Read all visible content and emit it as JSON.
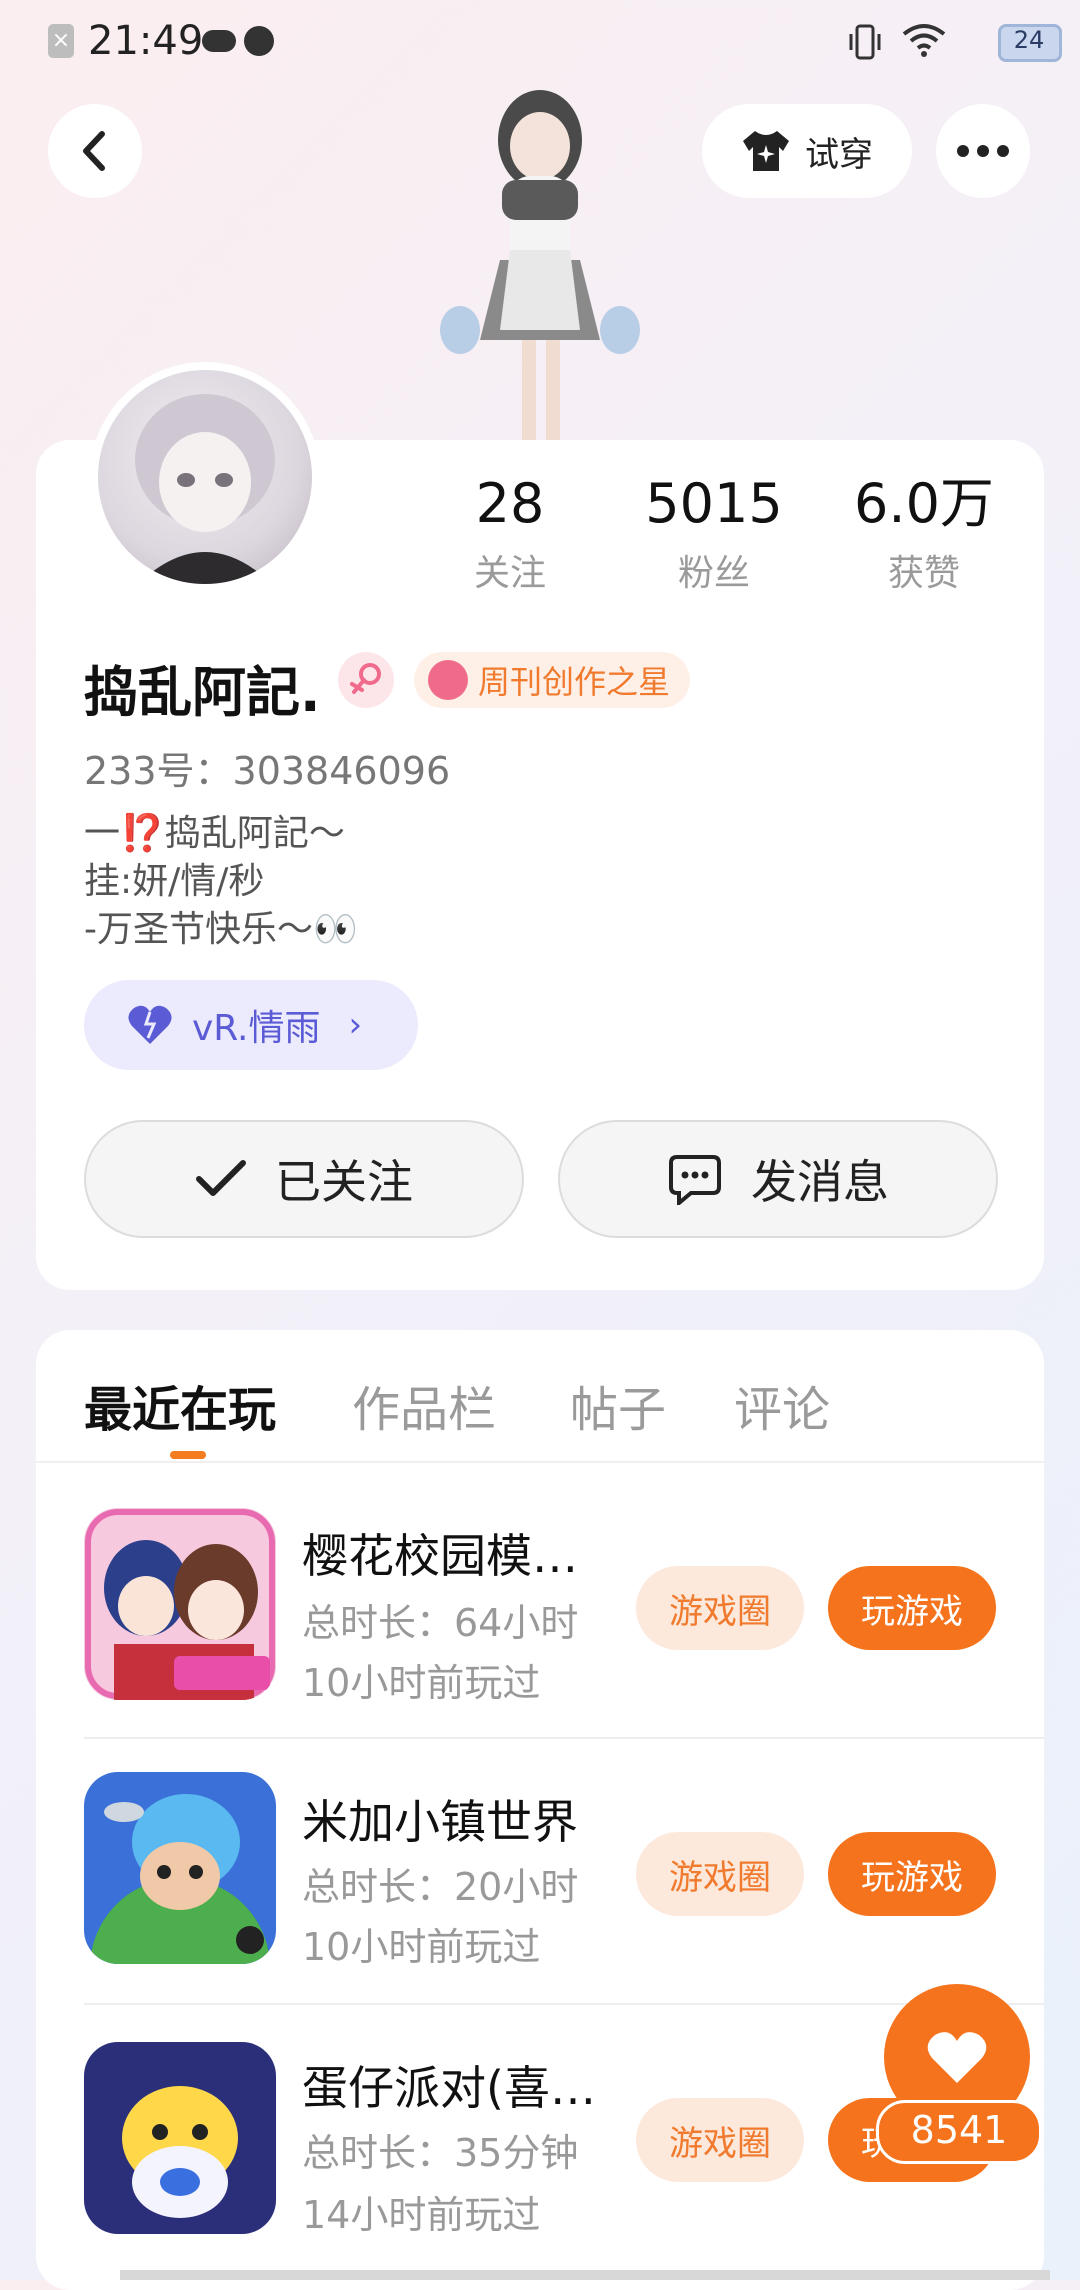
{
  "status_bar": {
    "time": "21:49",
    "battery": "24"
  },
  "header": {
    "try_on_label": "试穿",
    "back_icon": "chevron-left-icon",
    "more_icon": "more-dots-icon",
    "tryon_icon": "shirt-sparkle-icon"
  },
  "profile": {
    "stats": [
      {
        "value": "28",
        "label": "关注"
      },
      {
        "value": "5015",
        "label": "粉丝"
      },
      {
        "value": "6.0万",
        "label": "获赞"
      }
    ],
    "username": "捣乱阿記.",
    "creator_badge": "周刊创作之星",
    "user_id": "233号：303846096",
    "bio": "一⁉️捣乱阿記～\n挂:妍/情/秒\n-万圣节快乐～👀",
    "cp_name": "vR.情雨",
    "follow_label": "已关注",
    "message_label": "发消息",
    "accent_color": "#f5731c"
  },
  "tabs": [
    {
      "label": "最近在玩",
      "active": true
    },
    {
      "label": "作品栏",
      "active": false
    },
    {
      "label": "帖子",
      "active": false
    },
    {
      "label": "评论",
      "active": false
    }
  ],
  "games": [
    {
      "title": "樱花校园模…",
      "duration": "总时长：64小时",
      "last_played": "10小时前玩过",
      "circle_label": "游戏圈",
      "play_label": "玩游戏"
    },
    {
      "title": "米加小镇世界",
      "duration": "总时长：20小时",
      "last_played": "10小时前玩过",
      "circle_label": "游戏圈",
      "play_label": "玩游戏"
    },
    {
      "title": "蛋仔派对(喜…",
      "duration": "总时长：35分钟",
      "last_played": "14小时前玩过",
      "circle_label": "游戏圈",
      "play_label": "玩游戏"
    }
  ],
  "like": {
    "count": "8541"
  }
}
